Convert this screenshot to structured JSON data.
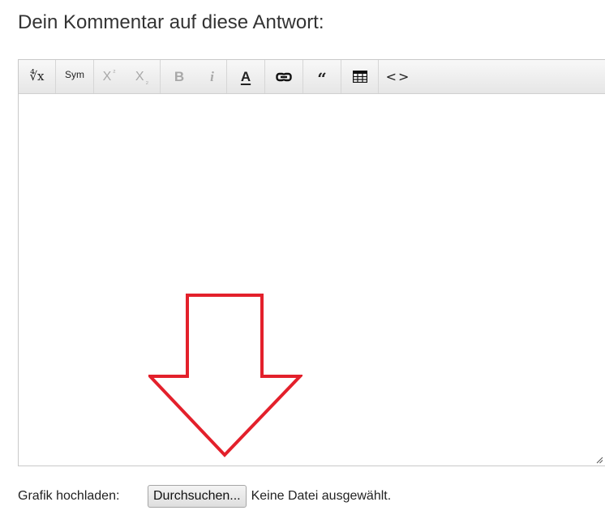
{
  "heading": "Dein Kommentar auf diese Antwort:",
  "toolbar": {
    "formula": "∜x",
    "sym": "Sym",
    "superscript": "X",
    "superscript_mark": "²",
    "subscript": "X",
    "subscript_mark": "₂",
    "bold": "B",
    "italic": "i",
    "text_color": "A",
    "quote": "“",
    "code": "<>"
  },
  "upload": {
    "label": "Grafik hochladen:",
    "button": "Durchsuchen...",
    "status": "Keine Datei ausgewählt."
  },
  "colors": {
    "annotation_arrow": "#e3202b",
    "toolbar_bg": "#eeeeee",
    "border": "#c8c8c8"
  }
}
